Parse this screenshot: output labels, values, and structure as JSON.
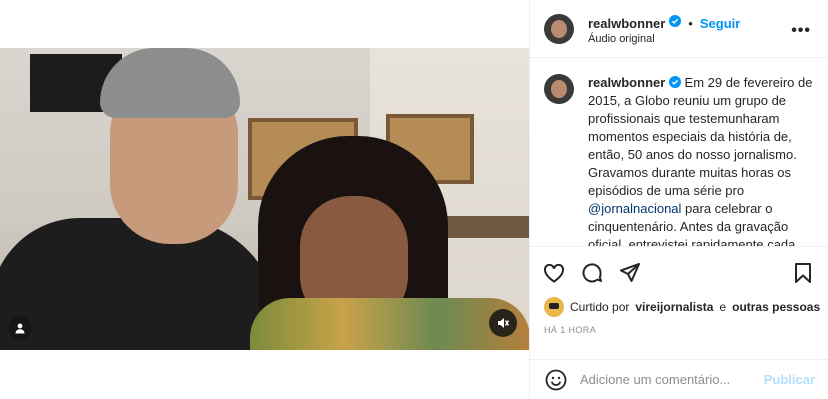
{
  "post": {
    "username": "realwbonner",
    "follow_label": "Seguir",
    "separator": "•",
    "audio": "Áudio original",
    "more_label": "•••",
    "caption_username": "realwbonner",
    "caption_part1": "Em 29 de fevereiro de 2015, a Globo reuniu um grupo de profissionais que testemunharam momentos especiais da história de, então, 50 anos do nosso jornalismo. Gravamos durante muitas horas os episódios de uma série pro ",
    "caption_mention": "@jornalnacional",
    "caption_part2": " para celebrar o cinquentenário. Antes da gravação oficial, entrevistei rapidamente cada participante daquele encontro."
  },
  "likes": {
    "prefix": "Curtido por",
    "user": "vireijornalista",
    "connector": "e",
    "others": "outras pessoas"
  },
  "time": "HÁ 1 HORA",
  "comment": {
    "placeholder": "Adicione um comentário...",
    "publish_label": "Publicar"
  },
  "colors": {
    "accent": "#0095f6",
    "publish_disabled": "#b2dffc",
    "mention": "#00376b",
    "meta": "#8e8e8e"
  },
  "icons": [
    "user-tag-icon",
    "mute-icon",
    "verified-icon",
    "heart-icon",
    "comment-icon",
    "share-icon",
    "bookmark-icon",
    "emoji-icon",
    "more-icon"
  ]
}
